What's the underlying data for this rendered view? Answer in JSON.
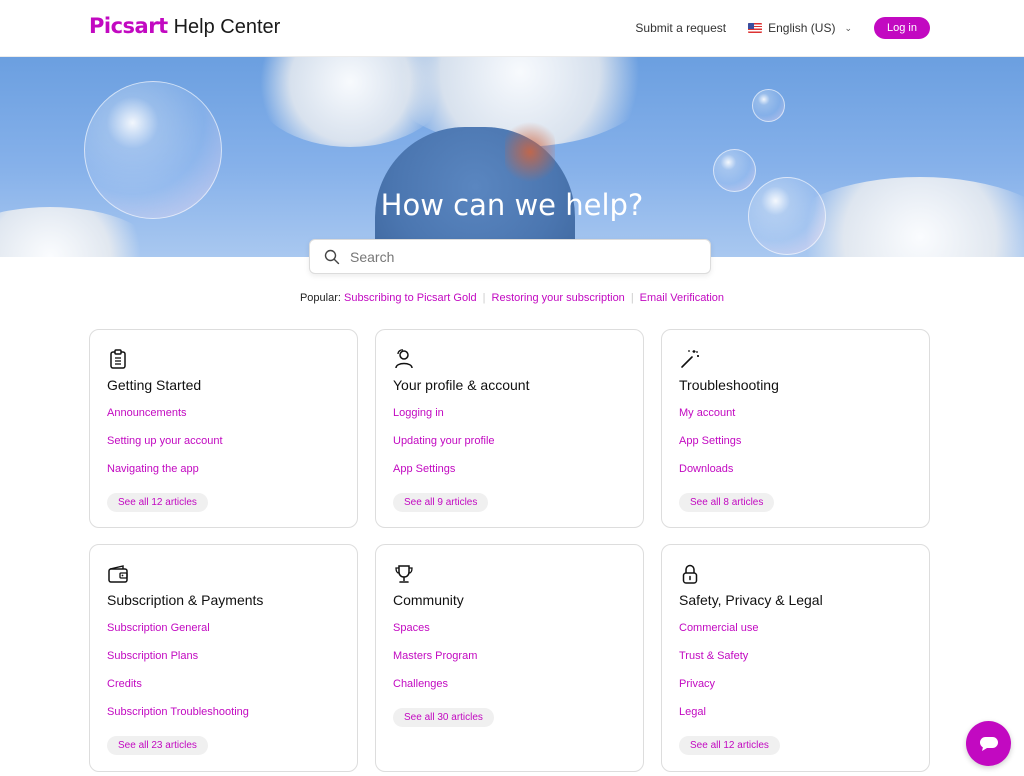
{
  "header": {
    "logo": "Picsart",
    "suffix": "Help Center",
    "submit_request": "Submit a request",
    "language": "English (US)",
    "login": "Log in"
  },
  "hero": {
    "title": "How can we help?"
  },
  "search": {
    "placeholder": "Search"
  },
  "popular": {
    "label": "Popular:",
    "links": [
      "Subscribing to Picsart Gold",
      "Restoring your subscription",
      "Email Verification"
    ]
  },
  "categories": [
    {
      "icon": "clipboard-icon",
      "title": "Getting Started",
      "links": [
        "Announcements",
        "Setting up your account",
        "Navigating the app"
      ],
      "see_all": "See all 12 articles"
    },
    {
      "icon": "profile-icon",
      "title": "Your profile & account",
      "links": [
        "Logging in",
        "Updating your profile",
        "App Settings"
      ],
      "see_all": "See all 9 articles"
    },
    {
      "icon": "magic-wand-icon",
      "title": "Troubleshooting",
      "links": [
        "My account",
        "App Settings",
        "Downloads"
      ],
      "see_all": "See all 8 articles"
    },
    {
      "icon": "wallet-icon",
      "title": "Subscription & Payments",
      "links": [
        "Subscription General",
        "Subscription Plans",
        "Credits",
        "Subscription Troubleshooting"
      ],
      "see_all": "See all 23 articles"
    },
    {
      "icon": "trophy-icon",
      "title": "Community",
      "links": [
        "Spaces",
        "Masters Program",
        "Challenges"
      ],
      "see_all": "See all 30 articles"
    },
    {
      "icon": "lock-icon",
      "title": "Safety, Privacy & Legal",
      "links": [
        "Commercial use",
        "Trust & Safety",
        "Privacy",
        "Legal"
      ],
      "see_all": "See all 12 articles"
    }
  ],
  "colors": {
    "accent": "#c209c1",
    "sky": "#7aa8e6"
  },
  "chat": {
    "icon": "chat-icon"
  }
}
